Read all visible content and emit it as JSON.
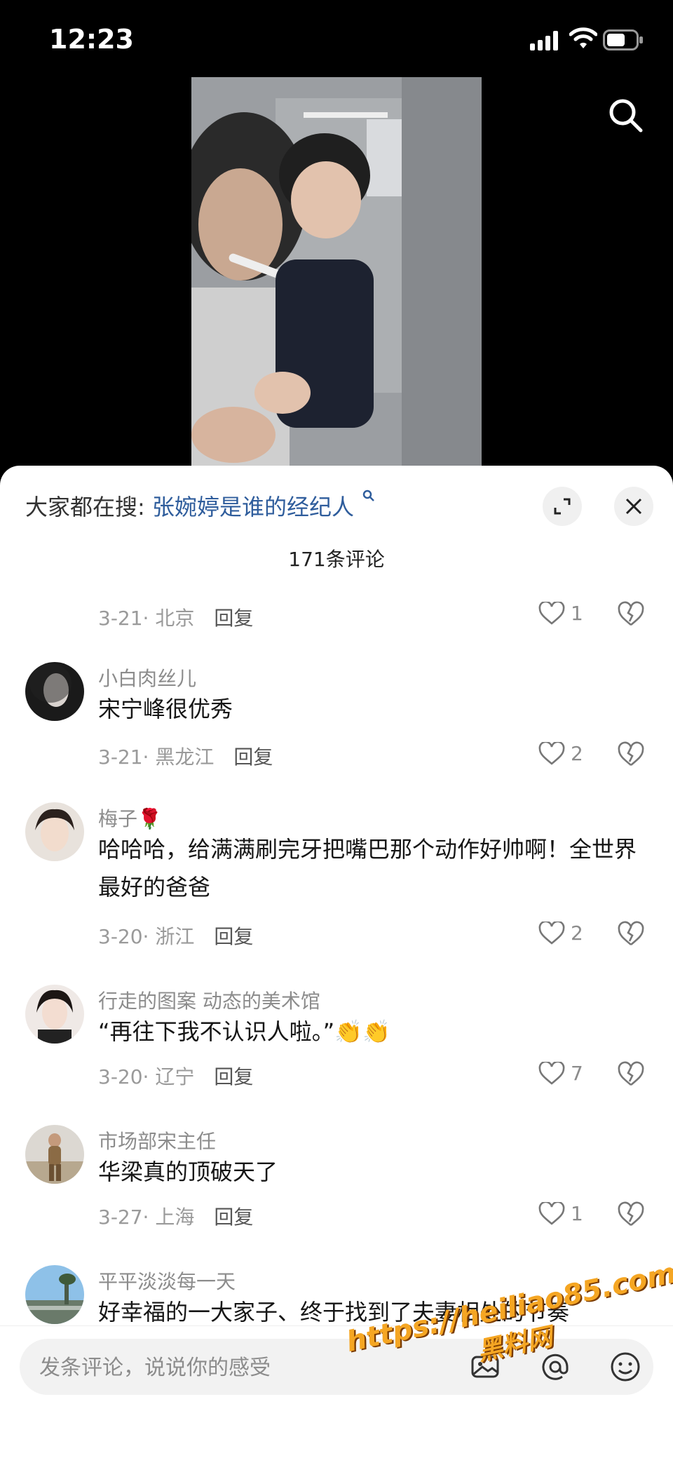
{
  "status": {
    "time": "12:23"
  },
  "hot_search": {
    "prefix": "大家都在搜:",
    "query": "张婉婷是谁的经纪人"
  },
  "comments_count": "171条评论",
  "comments": [
    {
      "name": "",
      "text": "",
      "date": "3-21· 北京",
      "reply": "回复",
      "likes": "1"
    },
    {
      "name": "小白肉丝儿",
      "text": "宋宁峰很优秀",
      "date": "3-21· 黑龙江",
      "reply": "回复",
      "likes": "2"
    },
    {
      "name": "梅子🌹",
      "text": "哈哈哈，给满满刷完牙把嘴巴那个动作好帅啊！全世界最好的爸爸",
      "date": "3-20· 浙江",
      "reply": "回复",
      "likes": "2"
    },
    {
      "name": "行走的图案 动态的美术馆",
      "text": "“再往下我不认识人啦。”👏👏",
      "date": "3-20· 辽宁",
      "reply": "回复",
      "likes": "7"
    },
    {
      "name": "市场部宋主任",
      "text": "华梁真的顶破天了",
      "date": "3-27· 上海",
      "reply": "回复",
      "likes": "1"
    },
    {
      "name": "平平淡淡每一天",
      "text": "好幸福的一大家子、终于找到了夫妻相处的节奏",
      "date": "",
      "reply": "",
      "likes": ""
    }
  ],
  "input": {
    "placeholder": "发条评论，说说你的感受"
  },
  "watermark": {
    "line1": "https://heiliao85.com",
    "line2": "黑料网"
  },
  "colors": {
    "accent_link": "#2f5d9c",
    "watermark": "#f5a623"
  },
  "icons": [
    "search-icon",
    "expand-icon",
    "close-icon",
    "heart-icon",
    "broken-heart-icon",
    "image-icon",
    "at-icon",
    "emoji-icon"
  ]
}
